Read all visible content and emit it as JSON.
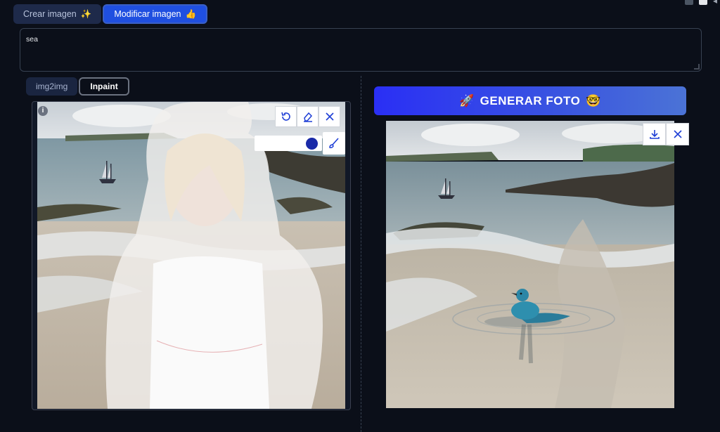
{
  "top_tabs": [
    {
      "label": "Crear imagen",
      "emoji": "✨",
      "active": false
    },
    {
      "label": "Modificar imagen",
      "emoji": "👍",
      "active": true
    }
  ],
  "prompt": {
    "value": "sea"
  },
  "sub_tabs": [
    {
      "label": "img2img",
      "active": false
    },
    {
      "label": "Inpaint",
      "active": true
    }
  ],
  "editor": {
    "info_icon": "i",
    "tools": [
      "undo-icon",
      "eraser-icon",
      "close-icon"
    ],
    "brush_icon": "brush-icon",
    "brush_color": "#1a2aa8"
  },
  "generate": {
    "label": "GENERAR FOTO",
    "left_emoji": "🚀",
    "right_emoji": "🤓"
  },
  "output": {
    "tools": [
      "download-icon",
      "close-icon"
    ]
  },
  "colors": {
    "accent": "#1f4fe0",
    "background": "#0b0f19"
  }
}
